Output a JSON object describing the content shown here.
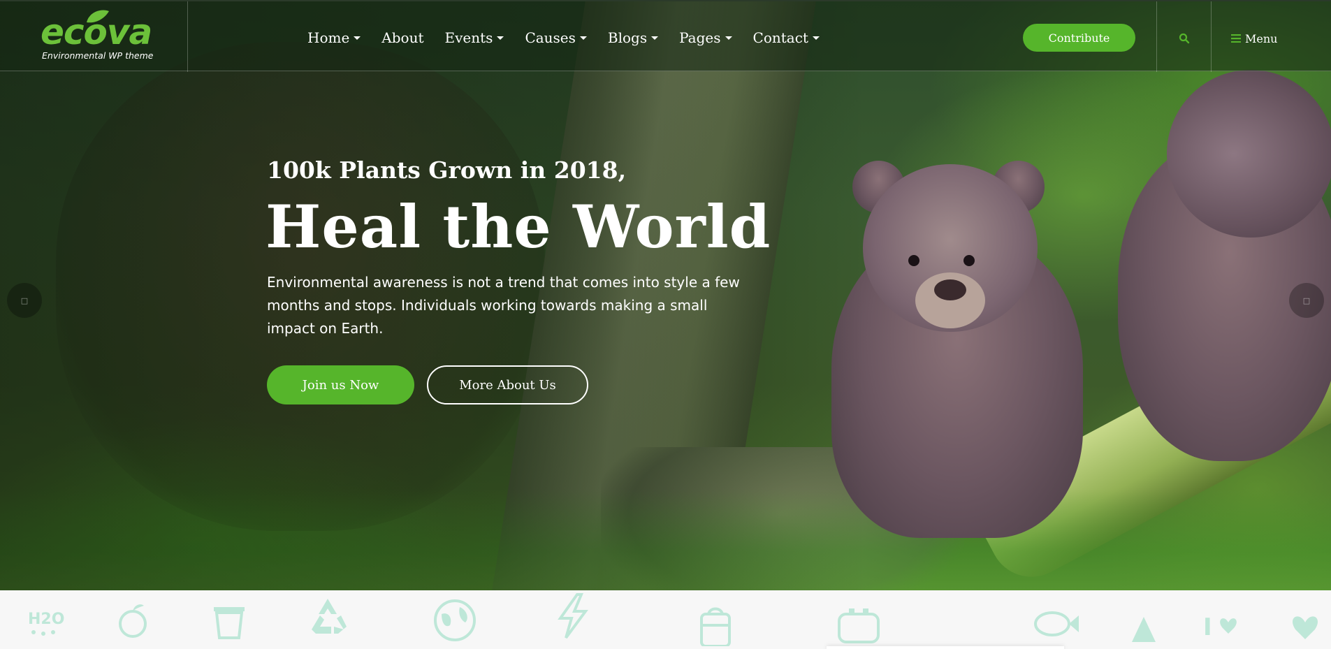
{
  "brand": {
    "name": "ecova",
    "tagline": "Environmental WP theme",
    "accent_color": "#56b52b"
  },
  "nav": {
    "items": [
      {
        "label": "Home",
        "has_dropdown": true
      },
      {
        "label": "About",
        "has_dropdown": false
      },
      {
        "label": "Events",
        "has_dropdown": true
      },
      {
        "label": "Causes",
        "has_dropdown": true
      },
      {
        "label": "Blogs",
        "has_dropdown": true
      },
      {
        "label": "Pages",
        "has_dropdown": true
      },
      {
        "label": "Contact",
        "has_dropdown": true
      }
    ],
    "contribute_label": "Contribute",
    "search_icon": "search-icon",
    "menu_label": "Menu",
    "menu_icon": "hamburger-icon"
  },
  "hero": {
    "subtitle": "100k Plants Grown in 2018,",
    "title": "Heal the World",
    "description": "Environmental awareness is not a trend that comes into style a few months and stops. Individuals working towards making a small impact on Earth.",
    "primary_button": "Join us Now",
    "secondary_button": "More About Us",
    "prev_icon": "arrow-left-icon",
    "next_icon": "arrow-right-icon"
  },
  "eco_icons": [
    "h2o-icon",
    "apple-icon",
    "trash-bin-icon",
    "recycle-icon",
    "globe-icon",
    "lightning-icon",
    "barrel-icon",
    "battery-icon",
    "fish-icon",
    "tree-icon",
    "i-love-icon",
    "heart-hands-icon"
  ]
}
